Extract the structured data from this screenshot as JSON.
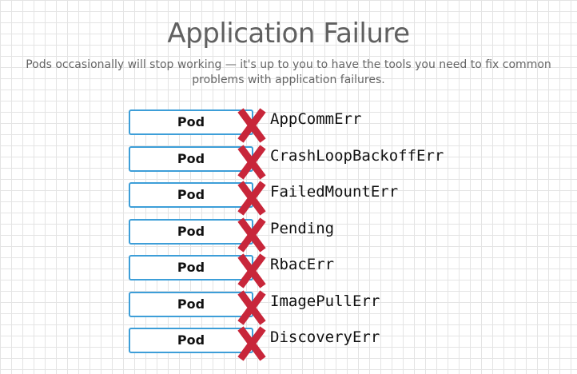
{
  "title": "Application Failure",
  "subtitle": "Pods occasionally will stop working — it's up to you to have the tools you need to fix common problems with application failures.",
  "pod_label": "Pod",
  "x_color": "#c8263a",
  "pod_border_color": "#3d9ed8",
  "errors": [
    "AppCommErr",
    "CrashLoopBackoffErr",
    "FailedMountErr",
    "Pending",
    "RbacErr",
    "ImagePullErr",
    "DiscoveryErr"
  ]
}
